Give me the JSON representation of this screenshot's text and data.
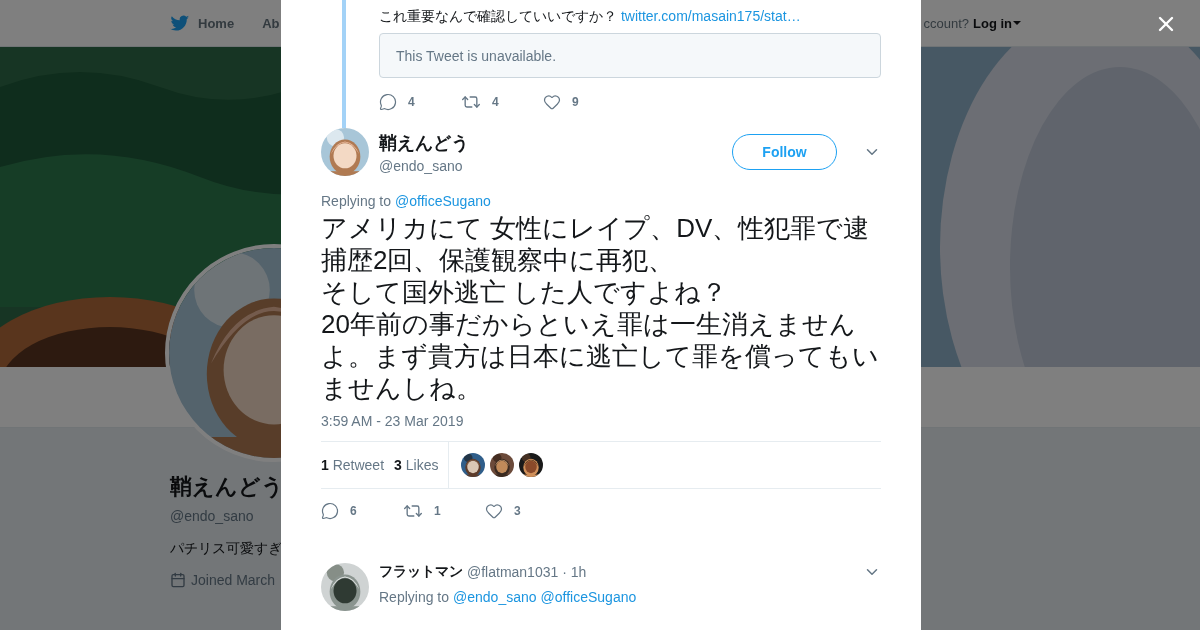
{
  "nav": {
    "items": [
      {
        "label": "Home",
        "kind": "home"
      },
      {
        "label": "Ab",
        "kind": "plain"
      }
    ],
    "login_prompt": "ccount?",
    "login": "Log in"
  },
  "profile": {
    "banner": {
      "kind": "picture"
    },
    "avatar": {
      "kind": "picture"
    },
    "name": "鞘えんどう",
    "handle": "@endo_sano",
    "bio": "パチリス可愛すぎ",
    "joined": "Joined March"
  },
  "modal": {
    "parent_tweet": {
      "text": "これ重要なんで確認していいですか？",
      "link": "twitter.com/masain175/stat…",
      "quoted": "This Tweet is unavailable.",
      "actions": [
        {
          "kind": "reply",
          "count": "4"
        },
        {
          "kind": "retweet",
          "count": "4"
        },
        {
          "kind": "like",
          "count": "9"
        }
      ]
    },
    "tweet": {
      "avatar": {
        "kind": "picture"
      },
      "name": "鞘えんどう",
      "handle": "@endo_sano",
      "follow": "Follow",
      "replying_label": "Replying to",
      "replying_to": [
        "@officeSugano"
      ],
      "text": [
        "アメリカにて 女性にレイプ、DV、性犯罪で逮捕歴2回、保護観察中に再犯、",
        "そして国外逃亡 した人ですよね？",
        "20年前の事だからといえ罪は一生消えませんよ。まず貴方は日本に逃亡して罪を償ってもいませんしね。"
      ],
      "timestamp": "3:59 AM - 23 Mar 2019",
      "stats": [
        "**1** Retweet",
        "**3** Likes"
      ],
      "likers": [
        {
          "kind": "picture"
        },
        {
          "kind": "picture"
        },
        {
          "kind": "picture"
        }
      ],
      "actions": [
        {
          "kind": "reply",
          "count": "6"
        },
        {
          "kind": "retweet",
          "count": "1"
        },
        {
          "kind": "like",
          "count": "3"
        }
      ]
    },
    "reply": {
      "avatar": {
        "kind": "picture"
      },
      "name": "フラットマン",
      "handle": "@flatman1031",
      "time": "· 1h",
      "replying_label": "Replying to",
      "replying_to": [
        "@endo_sano",
        "@officeSugano"
      ]
    }
  }
}
